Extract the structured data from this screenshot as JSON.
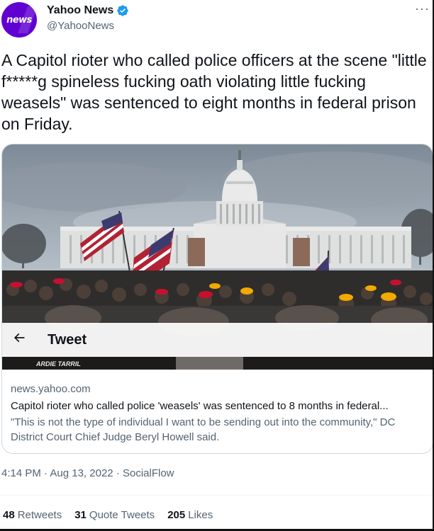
{
  "account": {
    "avatar_text": "news",
    "display_name": "Yahoo News",
    "handle": "@YahooNews",
    "verified": true,
    "brand_color": "#6001d2"
  },
  "tweet": {
    "text": "A Capitol rioter who called police officers at the scene \"little f*****g spineless fucking oath violating little fucking weasels\" was sentenced to eight months in federal prison on Friday."
  },
  "card": {
    "overlay_title": "Tweet",
    "banner_text": "ARDIE TARRIL",
    "domain": "news.yahoo.com",
    "title": "Capitol rioter who called police 'weasels' was sentenced to 8 months in federal...",
    "description": "\"This is not the type of individual I want to be sending out into the community,\" DC District Court Chief Judge Beryl Howell said."
  },
  "meta": {
    "time": "4:14 PM",
    "date": "Aug 13, 2022",
    "source": "SocialFlow",
    "sep": "·"
  },
  "stats": {
    "retweets_count": "48",
    "retweets_label": "Retweets",
    "quotes_count": "31",
    "quotes_label": "Quote Tweets",
    "likes_count": "205",
    "likes_label": "Likes"
  },
  "icons": {
    "more": "more-horizontal-icon",
    "back": "arrow-left-icon",
    "verified": "verified-badge-icon"
  },
  "colors": {
    "text_primary": "#0f1419",
    "text_secondary": "#536471",
    "verified_blue": "#1d9bf0",
    "border": "#cfd9de"
  }
}
